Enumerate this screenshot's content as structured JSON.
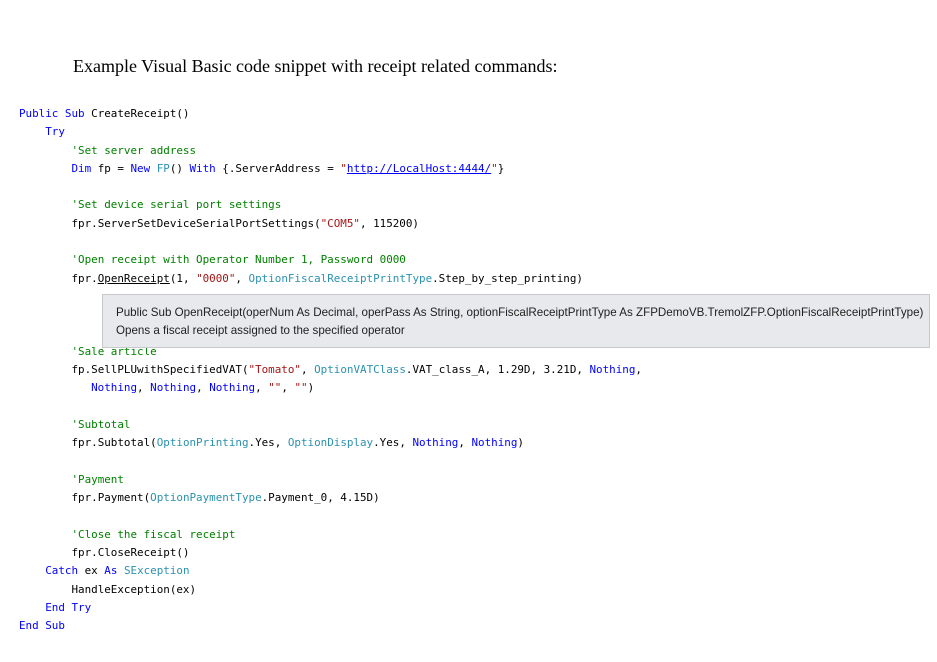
{
  "heading": "Example Visual Basic code snippet with receipt related commands:",
  "code": {
    "l1_kw1": "Public",
    "l1_kw2": "Sub",
    "l1_rest": " CreateReceipt()",
    "l2_try": "Try",
    "l3_comment": "'Set server address",
    "l4_dim": "Dim",
    "l4_a": " fp = ",
    "l4_new": "New",
    "l4_sp": " ",
    "l4_fp": "FP",
    "l4_b": "() ",
    "l4_with": "With",
    "l4_c": " {.ServerAddress = ",
    "l4_q1": "\"",
    "l4_url": "http://LocalHost:4444/",
    "l4_q2": "\"",
    "l4_d": "}",
    "l6_comment": "'Set device serial port settings",
    "l7_a": "fpr.ServerSetDeviceSerialPortSettings(",
    "l7_str": "\"COM5\"",
    "l7_b": ", 115200)",
    "l9_comment": "'Open receipt with Operator Number 1, Password 0000",
    "l10_a": "fpr.",
    "l10_method": "OpenReceipt",
    "l10_b": "(1, ",
    "l10_str": "\"0000\"",
    "l10_c": ", ",
    "l10_type": "OptionFiscalReceiptPrintType",
    "l10_d": ".Step_by_step_printing)",
    "l14_comment": "'Sale article",
    "l15_a": "fp.SellPLUwithSpecifiedVAT(",
    "l15_str": "\"Tomato\"",
    "l15_b": ", ",
    "l15_type": "OptionVATClass",
    "l15_c": ".VAT_class_A, 1.29D, 3.21D, ",
    "l15_nothing": "Nothing",
    "l15_d": ",",
    "l16_n1": "Nothing",
    "l16_c1": ", ",
    "l16_n2": "Nothing",
    "l16_c2": ", ",
    "l16_n3": "Nothing",
    "l16_c3": ", ",
    "l16_s1": "\"\"",
    "l16_c4": ", ",
    "l16_s2": "\"\"",
    "l16_end": ")",
    "l18_comment": "'Subtotal",
    "l19_a": "fpr.Subtotal(",
    "l19_t1": "OptionPrinting",
    "l19_b": ".Yes, ",
    "l19_t2": "OptionDisplay",
    "l19_c": ".Yes, ",
    "l19_n1": "Nothing",
    "l19_d": ", ",
    "l19_n2": "Nothing",
    "l19_e": ")",
    "l21_comment": "'Payment",
    "l22_a": "fpr.Payment(",
    "l22_type": "OptionPaymentType",
    "l22_b": ".Payment_0, 4.15D)",
    "l24_comment": "'Close the fiscal receipt",
    "l25_code": "fpr.CloseReceipt()",
    "l26_catch": "Catch",
    "l26_a": " ex ",
    "l26_as": "As",
    "l26_sp": " ",
    "l26_type": "SException",
    "l27_code": "HandleException(ex)",
    "l28_end": "End",
    "l28_sp": " ",
    "l28_try": "Try",
    "l29_end": "End",
    "l29_sp": " ",
    "l29_sub": "Sub"
  },
  "tooltip": {
    "signature": "Public Sub OpenReceipt(operNum As Decimal, operPass As String, optionFiscalReceiptPrintType As ZFPDemoVB.TremolZFP.OptionFiscalReceiptPrintType)",
    "description": "Opens a fiscal receipt assigned to the specified operator"
  },
  "colors": {
    "keyword": "#0000ff",
    "comment": "#008000",
    "string": "#a31515",
    "type": "#2b91af",
    "tooltip_bg": "#e8e9ed"
  }
}
